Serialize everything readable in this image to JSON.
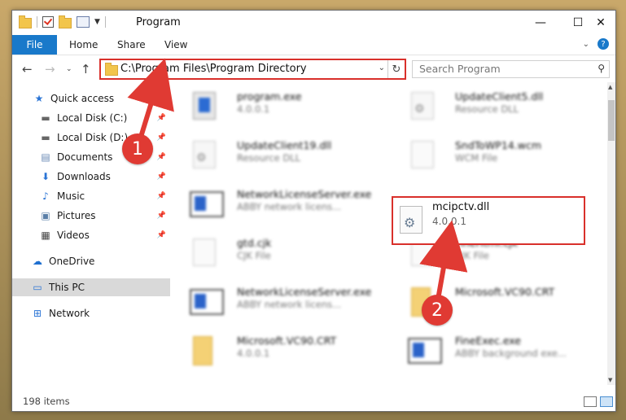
{
  "window": {
    "title": "Program",
    "minimize_glyph": "—",
    "maximize_glyph": "☐",
    "close_glyph": "✕"
  },
  "ribbon": {
    "tabs": [
      "File",
      "Home",
      "Share",
      "View"
    ]
  },
  "address": {
    "path": "C:\\Program Files\\Program Directory",
    "search_placeholder": "Search Program"
  },
  "sidebar": {
    "items": [
      {
        "label": "Quick access",
        "icon": "star-icon",
        "pinned": false
      },
      {
        "label": "Local Disk (C:)",
        "icon": "drive-icon",
        "pinned": true
      },
      {
        "label": "Local Disk (D:)",
        "icon": "drive-icon",
        "pinned": true
      },
      {
        "label": "Documents",
        "icon": "documents-icon",
        "pinned": true
      },
      {
        "label": "Downloads",
        "icon": "downloads-icon",
        "pinned": true
      },
      {
        "label": "Music",
        "icon": "music-icon",
        "pinned": true
      },
      {
        "label": "Pictures",
        "icon": "pictures-icon",
        "pinned": true
      },
      {
        "label": "Videos",
        "icon": "videos-icon",
        "pinned": true
      },
      {
        "label": "OneDrive",
        "icon": "cloud-icon",
        "pinned": false
      },
      {
        "label": "This PC",
        "icon": "computer-icon",
        "pinned": false,
        "selected": true
      },
      {
        "label": "Network",
        "icon": "network-icon",
        "pinned": false
      }
    ]
  },
  "files": [
    {
      "name": "program.exe",
      "sub": "4.0.0.1",
      "icon": "program-icon"
    },
    {
      "name": "UpdateClient5.dll",
      "sub": "Resource DLL",
      "icon": "dll-icon"
    },
    {
      "name": "UpdateClient19.dll",
      "sub": "Resource DLL",
      "icon": "dll-icon"
    },
    {
      "name": "SndToWP14.wcm",
      "sub": "WCM File",
      "icon": "file-icon"
    },
    {
      "name": "NetworkLicenseServer.exe",
      "sub": "ABBY network licens...",
      "icon": "app-window-icon"
    },
    {
      "name": "mcipctv.dll",
      "sub": "4.0.0.1",
      "icon": "dll-gear-icon",
      "highlighted": true
    },
    {
      "name": "gtd.cjk",
      "sub": "CJK File",
      "icon": "file-icon"
    },
    {
      "name": "FineHtml.cjk",
      "sub": "CJK File",
      "icon": "file-icon"
    },
    {
      "name": "NetworkLicenseServer.exe",
      "sub": "ABBY network licens...",
      "icon": "app-window-icon"
    },
    {
      "name": "Microsoft.VC90.CRT",
      "sub": "",
      "icon": "folder-icon"
    },
    {
      "name": "Microsoft.VC90.CRT",
      "sub": "4.0.0.1",
      "icon": "folder-icon"
    },
    {
      "name": "FineExec.exe",
      "sub": "ABBY background exe...",
      "icon": "app-window-icon"
    }
  ],
  "status": {
    "item_count": "198 items"
  },
  "annotations": {
    "step1": "1",
    "step2": "2",
    "color": "#e03a33"
  }
}
